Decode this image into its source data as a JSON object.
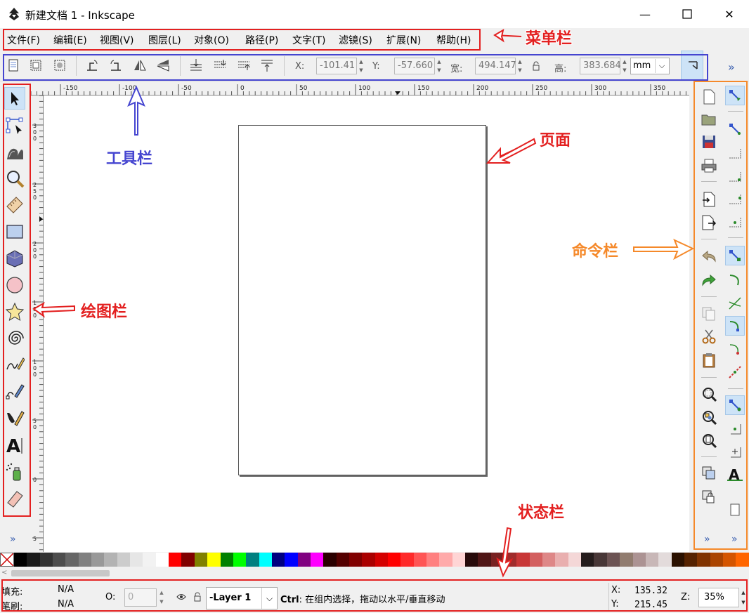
{
  "window": {
    "title": "新建文档 1 - Inkscape",
    "minimize_glyph": "—",
    "maximize_glyph": "☐",
    "close_glyph": "✕"
  },
  "menu": [
    "文件(F)",
    "编辑(E)",
    "视图(V)",
    "图层(L)",
    "对象(O)",
    "路径(P)",
    "文字(T)",
    "滤镜(S)",
    "扩展(N)",
    "帮助(H)"
  ],
  "controls": {
    "x_label": "X:",
    "x_value": "-101.41",
    "y_label": "Y:",
    "y_value": "-57.660",
    "w_label": "宽:",
    "w_value": "494.147",
    "h_label": "高:",
    "h_value": "383.684",
    "unit": "mm",
    "overflow": "»"
  },
  "ruler": {
    "labels": [
      "-150",
      "-100",
      "-50",
      "0",
      "50",
      "100",
      "150",
      "200",
      "250",
      "300",
      "350"
    ],
    "left_labels": [
      "3\n0\n0",
      "2\n5\n0",
      "2\n0\n0",
      "1\n5\n0",
      "1\n0\n0",
      "5\n0",
      "0",
      "5"
    ]
  },
  "toolbox": {
    "tools": [
      "selector-tool",
      "node-tool",
      "tweak-tool",
      "zoom-tool",
      "measure-tool",
      "rect-tool",
      "3dbox-tool",
      "ellipse-tool",
      "star-tool",
      "spiral-tool",
      "pencil-tool",
      "pen-tool",
      "calligraphy-tool",
      "text-tool",
      "spray-tool",
      "eraser-tool"
    ],
    "overflow": "»"
  },
  "commands": {
    "overflow": "»",
    "snap_overflow": "»"
  },
  "palette": {
    "colors": [
      "#000000",
      "#1a1a1a",
      "#333333",
      "#4d4d4d",
      "#666666",
      "#808080",
      "#999999",
      "#b3b3b3",
      "#cccccc",
      "#e6e6e6",
      "#f2f2f2",
      "#ffffff",
      "#ff0000",
      "#800000",
      "#808000",
      "#ffff00",
      "#008000",
      "#00ff00",
      "#008080",
      "#00ffff",
      "#000080",
      "#0000ff",
      "#800080",
      "#ff00ff",
      "#2b0000",
      "#550000",
      "#800000",
      "#aa0000",
      "#d40000",
      "#ff0000",
      "#ff2a2a",
      "#ff5555",
      "#ff8080",
      "#ffaaaa",
      "#ffd5d5",
      "#280b0b",
      "#501616",
      "#782121",
      "#a02c2c",
      "#c83737",
      "#d35f5f",
      "#de8787",
      "#e9afaf",
      "#f4d7d7",
      "#241c1c",
      "#483737",
      "#6c5353",
      "#917c6f",
      "#ac9393",
      "#c8b7b7",
      "#e3dbdb",
      "#2b1100",
      "#552200",
      "#803300",
      "#aa4400",
      "#d45500",
      "#ff6600"
    ]
  },
  "status": {
    "fill_label": "填充:",
    "fill_value": "N/A",
    "stroke_label": "笔刷:",
    "stroke_value": "N/A",
    "opacity_label": "O:",
    "opacity_value": "0",
    "layer": "-Layer 1",
    "hint_key": "Ctrl",
    "hint_text": ": 在组内选择，拖动以水平/垂直移动",
    "x_label": "X:",
    "x_value": "135.32",
    "y_label": "Y:",
    "y_value": "215.45",
    "zoom_label": "Z:",
    "zoom_value": "35%"
  },
  "annotations": {
    "menubar": "菜单栏",
    "toolbar": "工具栏",
    "page": "页面",
    "commandbar": "命令栏",
    "drawbar": "绘图栏",
    "statusbar": "状态栏"
  },
  "colors": {
    "red": "#e32020",
    "blue": "#4545d0",
    "orange": "#f5892a"
  }
}
